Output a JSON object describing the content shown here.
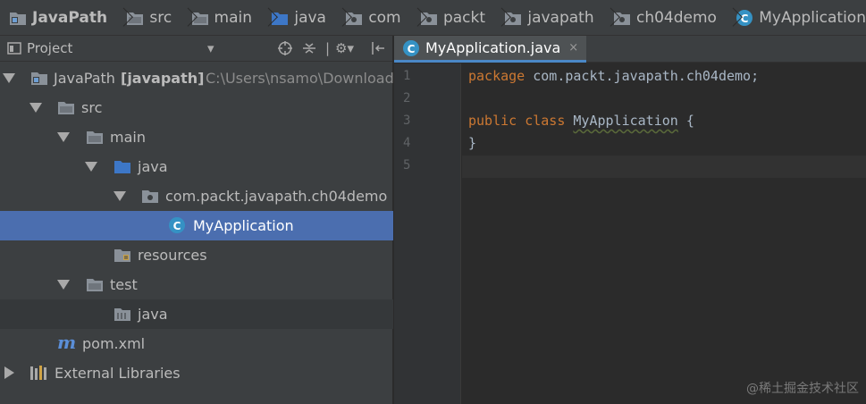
{
  "breadcrumb": {
    "items": [
      {
        "label": "JavaPath",
        "icon": "project-folder-icon"
      },
      {
        "label": "src",
        "icon": "folder-icon"
      },
      {
        "label": "main",
        "icon": "folder-icon"
      },
      {
        "label": "java",
        "icon": "source-folder-icon"
      },
      {
        "label": "com",
        "icon": "package-folder-icon"
      },
      {
        "label": "packt",
        "icon": "package-folder-icon"
      },
      {
        "label": "javapath",
        "icon": "package-folder-icon"
      },
      {
        "label": "ch04demo",
        "icon": "package-folder-icon"
      },
      {
        "label": "MyApplication",
        "icon": "java-class-icon"
      }
    ]
  },
  "project_panel": {
    "title": "Project",
    "tree": [
      {
        "label": "JavaPath",
        "badge": "[javapath]",
        "path": "C:\\Users\\nsamo\\Downloads",
        "icon": "project-module-icon",
        "expanded": true
      },
      {
        "label": "src",
        "icon": "folder-icon",
        "expanded": true
      },
      {
        "label": "main",
        "icon": "folder-icon",
        "expanded": true
      },
      {
        "label": "java",
        "icon": "source-folder-icon",
        "expanded": true
      },
      {
        "label": "com.packt.javapath.ch04demo",
        "icon": "package-icon",
        "expanded": true
      },
      {
        "label": "MyApplication",
        "icon": "java-class-icon",
        "selected": true
      },
      {
        "label": "resources",
        "icon": "resources-folder-icon"
      },
      {
        "label": "test",
        "icon": "folder-icon",
        "expanded": true
      },
      {
        "label": "java",
        "icon": "test-folder-icon"
      },
      {
        "label": "pom.xml",
        "icon": "maven-icon"
      },
      {
        "label": "External Libraries",
        "icon": "libraries-icon",
        "expanded": false
      }
    ]
  },
  "editor": {
    "tab_label": "MyApplication.java",
    "line_numbers": [
      "1",
      "2",
      "3",
      "4",
      "5"
    ],
    "lines": {
      "l1_kw": "package",
      "l1_rest": " com.packt.javapath.ch04demo;",
      "l3_kw": "public class",
      "l3_cls": "MyApplication",
      "l3_rest": " {",
      "l4": "}"
    }
  },
  "watermark": "@稀土掘金技术社区",
  "colors": {
    "selection": "#4b6eaf",
    "keyword": "#cc7832",
    "class_icon": "#3592c4",
    "folder_icon": "#8a9199",
    "source_folder": "#3d77c7"
  }
}
